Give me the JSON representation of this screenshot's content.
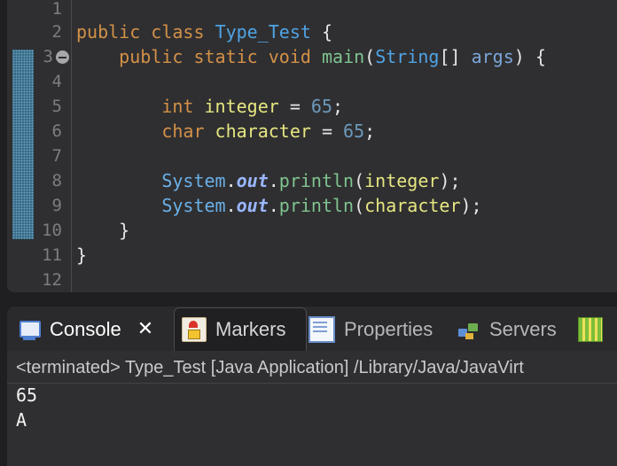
{
  "editor": {
    "line_numbers": [
      "1",
      "2",
      "3",
      "4",
      "5",
      "6",
      "7",
      "8",
      "9",
      "10",
      "11",
      "12"
    ],
    "line2": {
      "kw1": "public",
      "kw2": "class",
      "cls": "Type_Test",
      "brace": "{"
    },
    "line3": {
      "kw1": "public",
      "kw2": "static",
      "kw3": "void",
      "mth": "main",
      "open": "(",
      "type": "String",
      "arr": "[] ",
      "param": "args",
      "close": ") {"
    },
    "line5": {
      "type": "int",
      "name": "integer",
      "eq": " = ",
      "val": "65",
      "semi": ";"
    },
    "line6": {
      "type": "char",
      "name": "character",
      "eq": " = ",
      "val": "65",
      "semi": ";"
    },
    "line8": {
      "sys": "System",
      "dot1": ".",
      "fld": "out",
      "dot2": ".",
      "mth": "println",
      "open": "(",
      "arg": "integer",
      "close": ");"
    },
    "line9": {
      "sys": "System",
      "dot1": ".",
      "fld": "out",
      "dot2": ".",
      "mth": "println",
      "open": "(",
      "arg": "character",
      "close": ");"
    },
    "line10": {
      "brace": "}"
    },
    "line11": {
      "brace": "}"
    }
  },
  "panel": {
    "tabs": [
      {
        "label": "Console",
        "icon": "console-icon",
        "active": true
      },
      {
        "label": "Markers",
        "icon": "markers-icon"
      },
      {
        "label": "Properties",
        "icon": "properties-icon"
      },
      {
        "label": "Servers",
        "icon": "servers-icon"
      }
    ],
    "close_glyph": "✕",
    "status": "<terminated> Type_Test [Java Application] /Library/Java/JavaVirt",
    "output": [
      "65",
      "A"
    ]
  },
  "colors": {
    "keyword": "#d39148",
    "class_name": "#4fa3e4",
    "method": "#7fc48f",
    "variable": "#e6e682",
    "number": "#6c99bb",
    "background": "#2f2f31"
  }
}
